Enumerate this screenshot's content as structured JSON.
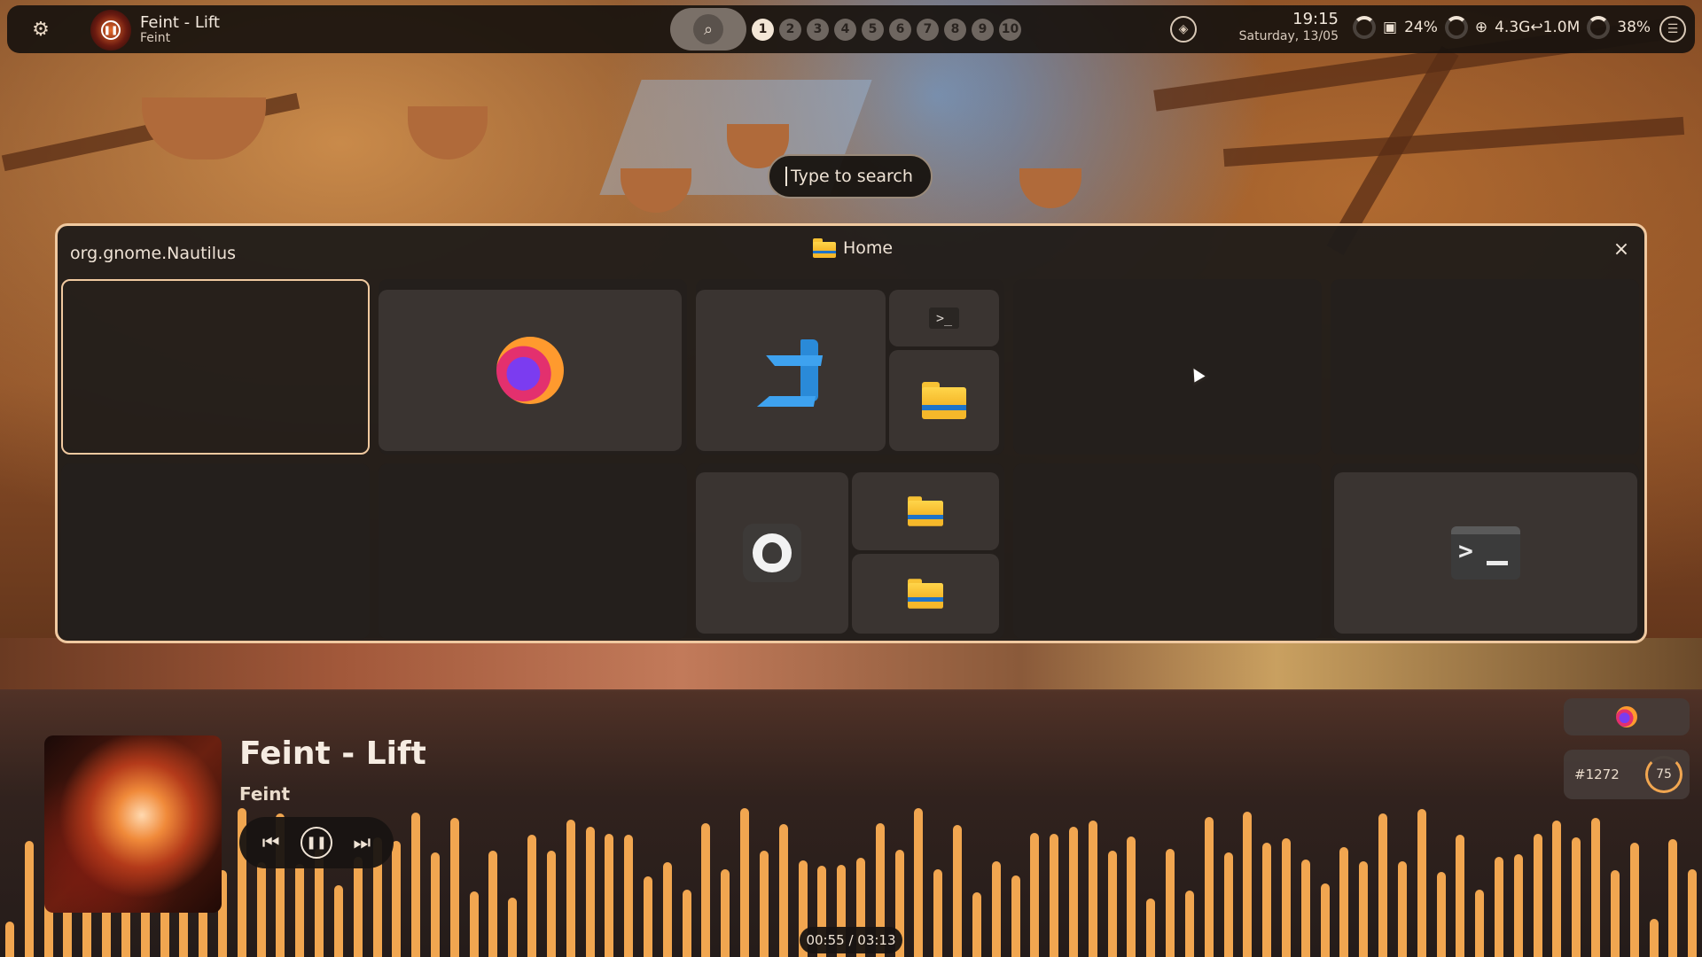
{
  "topbar": {
    "media_title": "Feint - Lift",
    "media_artist": "Feint",
    "workspaces": [
      "1",
      "2",
      "3",
      "4",
      "5",
      "6",
      "7",
      "8",
      "9",
      "10"
    ],
    "active_workspace": "1",
    "time": "19:15",
    "date": "Saturday, 13/05",
    "cpu": "24%",
    "network": "4.3G↩1.0M",
    "memory": "38%"
  },
  "search": {
    "placeholder": "Type to search"
  },
  "overview": {
    "active_app": "org.gnome.Nautilus",
    "active_window_title": "Home",
    "close_icon": "×"
  },
  "media": {
    "title": "Feint - Lift",
    "artist": "Feint",
    "position": "00:55 / 03:13",
    "notification_id": "#1272",
    "volume": "75",
    "controls": {
      "previous": "⏮",
      "pause": "❚❚",
      "next": "⏭"
    }
  },
  "colors": {
    "accent": "#f1a650",
    "panel": "#211d1a",
    "border": "#f0c9a0"
  }
}
